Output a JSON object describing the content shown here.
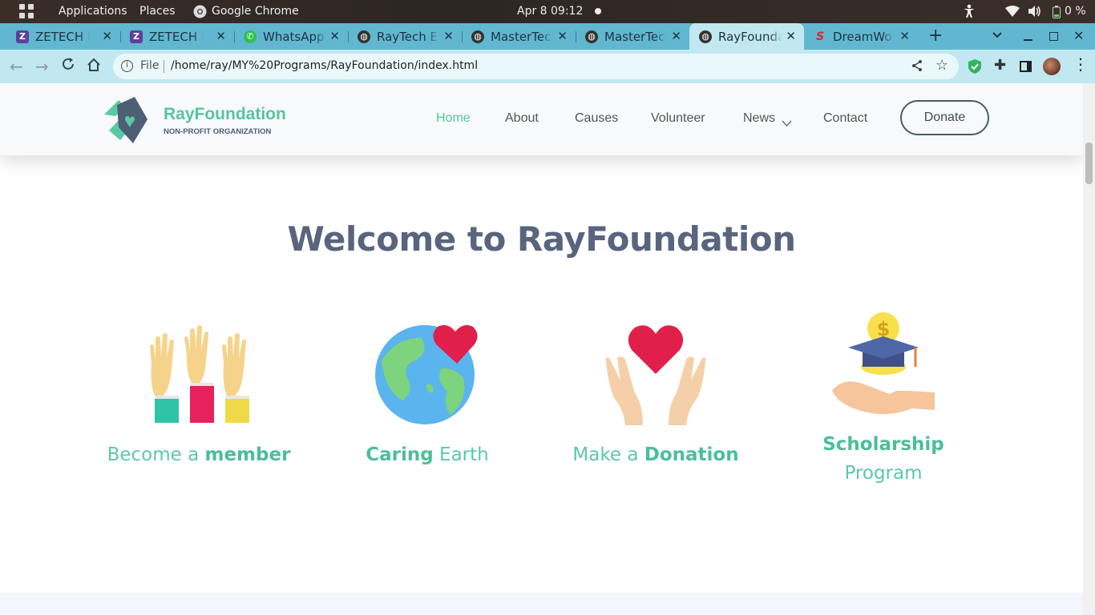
{
  "topbar": {
    "applications": "Applications",
    "places": "Places",
    "browser": "Google Chrome",
    "datetime": "Apr 8  09:12",
    "battery": "0 %"
  },
  "tabs": [
    {
      "label": "ZETECH UNIVERSITY",
      "icon": "zetech-icon"
    },
    {
      "label": "ZETECH UNIVERSITY",
      "icon": "zetech-icon"
    },
    {
      "label": "WhatsApp",
      "icon": "whatsapp-icon"
    },
    {
      "label": "RayTech Enterprises",
      "icon": "globe-icon"
    },
    {
      "label": "MasterTech",
      "icon": "globe-icon"
    },
    {
      "label": "MasterTech",
      "icon": "globe-icon"
    },
    {
      "label": "RayFoundation",
      "icon": "globe-icon",
      "active": true
    },
    {
      "label": "DreamWorks",
      "icon": "s-icon"
    }
  ],
  "omnibox": {
    "scheme": "File",
    "url": "/home/ray/MY%20Programs/RayFoundation/index.html"
  },
  "site": {
    "brand": "RayFoundation",
    "tagline": "NON-PROFIT ORGANIZATION",
    "nav": [
      "Home",
      "About",
      "Causes",
      "Volunteer",
      "News",
      "Contact"
    ],
    "donate": "Donate",
    "welcome": "Welcome to RayFoundation",
    "features": [
      {
        "pre": "Become a ",
        "bold": "member",
        "post": ""
      },
      {
        "pre": "",
        "bold": "Caring",
        "post": " Earth"
      },
      {
        "pre": "Make a ",
        "bold": "Donation",
        "post": ""
      },
      {
        "pre": "",
        "bold": "Scholarship",
        "post": "Program"
      }
    ]
  },
  "colors": {
    "accent": "#5ac9a4",
    "heading": "#59657f",
    "tabstrip": "#61b7cf",
    "toolbar": "#c1e8f0"
  }
}
